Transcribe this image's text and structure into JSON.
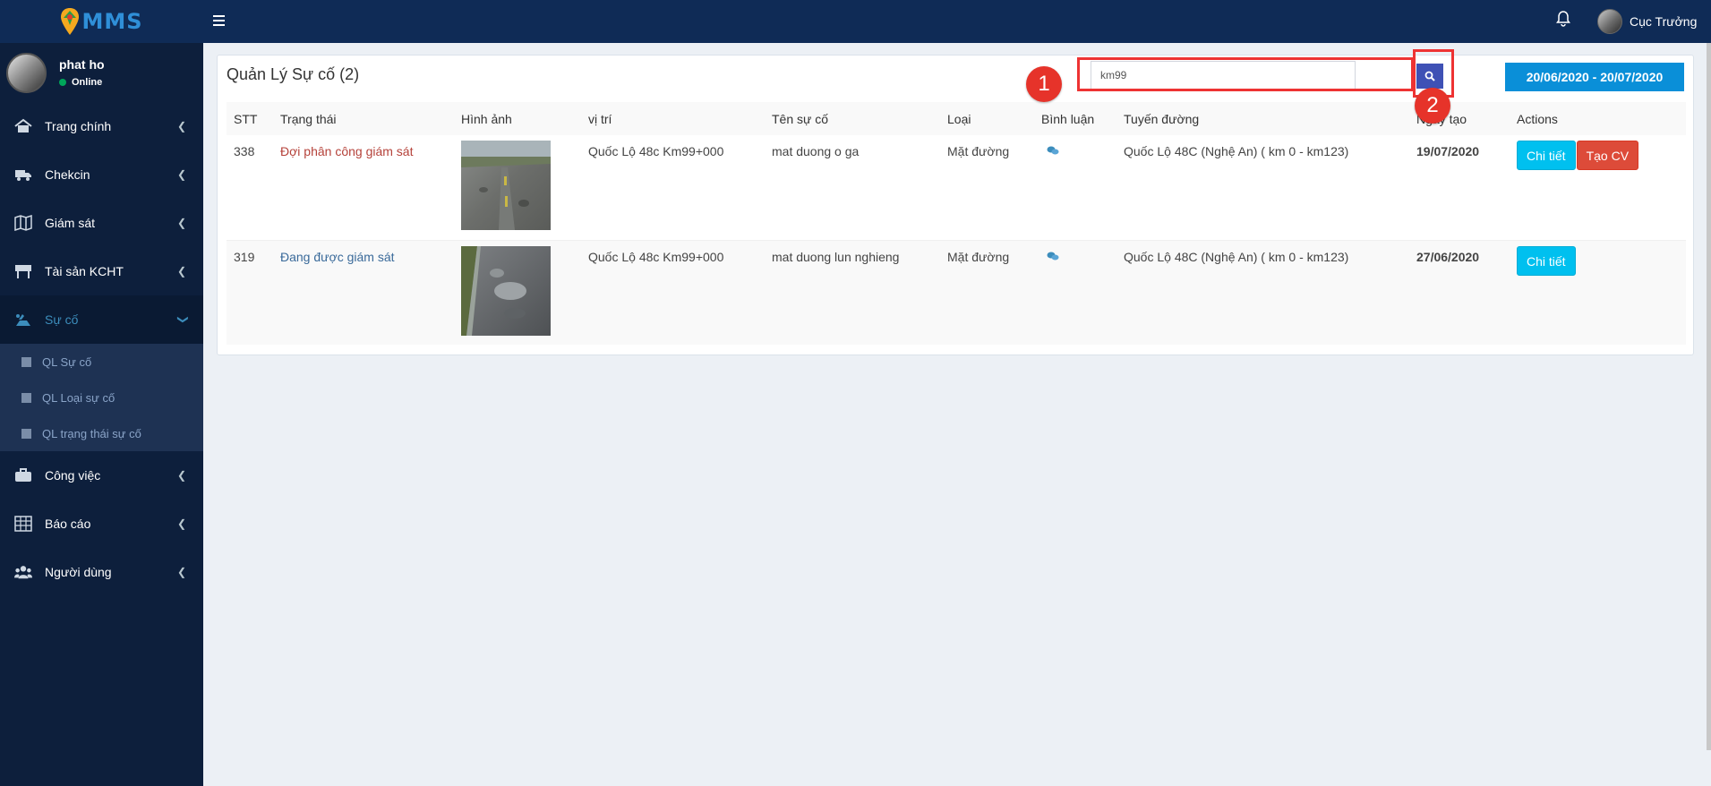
{
  "header": {
    "logo_text": "MMS",
    "username": "Cục Trưởng"
  },
  "sidebar": {
    "user_name": "phat ho",
    "user_status": "Online",
    "items": [
      {
        "label": "Trang chính",
        "icon": "home-icon"
      },
      {
        "label": "Chekcin",
        "icon": "truck-icon"
      },
      {
        "label": "Giám sát",
        "icon": "map-icon"
      },
      {
        "label": "Tài sản KCHT",
        "icon": "sign-icon"
      },
      {
        "label": "Sự cố",
        "icon": "road-incident-icon"
      },
      {
        "label": "Công việc",
        "icon": "briefcase-icon"
      },
      {
        "label": "Báo cáo",
        "icon": "table-icon"
      },
      {
        "label": "Người dùng",
        "icon": "users-icon"
      }
    ],
    "submenu": [
      {
        "label": "QL Sự cố"
      },
      {
        "label": "QL Loại sự cố"
      },
      {
        "label": "QL trạng thái sự cố"
      }
    ]
  },
  "main": {
    "title": "Quản Lý Sự cố (2)",
    "search_value": "km99",
    "date_range": "20/06/2020 - 20/07/2020",
    "annotations": {
      "badge1": "1",
      "badge2": "2"
    },
    "table": {
      "headers": [
        "STT",
        "Trạng thái",
        "Hình ảnh",
        "vị trí",
        "Tên sự cố",
        "Loại",
        "Bình luận",
        "Tuyến đường",
        "Ngày tạo",
        "Actions"
      ],
      "rows": [
        {
          "stt": "338",
          "status": "Đợi phân công giám sát",
          "position": "Quốc Lộ 48c Km99+000",
          "name": "mat duong o ga",
          "type": "Mặt đường",
          "route": "Quốc Lộ 48C (Nghệ An) ( km 0 - km123)",
          "date": "19/07/2020",
          "detail_label": "Chi tiết",
          "create_label": "Tạo CV"
        },
        {
          "stt": "319",
          "status": "Đang được giám sát",
          "position": "Quốc Lộ 48c Km99+000",
          "name": "mat duong lun nghieng",
          "type": "Mặt đường",
          "route": "Quốc Lộ 48C (Nghệ An) ( km 0 - km123)",
          "date": "27/06/2020",
          "detail_label": "Chi tiết"
        }
      ]
    }
  }
}
